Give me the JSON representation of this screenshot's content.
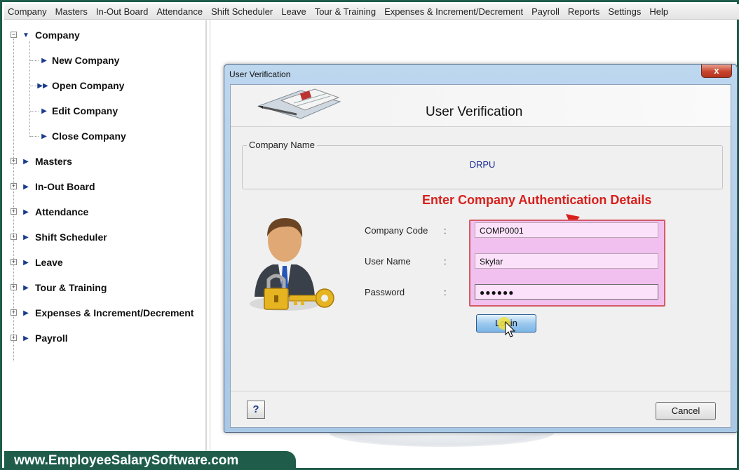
{
  "menu": [
    "Company",
    "Masters",
    "In-Out Board",
    "Attendance",
    "Shift Scheduler",
    "Leave",
    "Tour & Training",
    "Expenses & Increment/Decrement",
    "Payroll",
    "Reports",
    "Settings",
    "Help"
  ],
  "tree": {
    "root": "Company",
    "children": [
      "New Company",
      "Open Company",
      "Edit Company",
      "Close Company"
    ],
    "sections": [
      "Masters",
      "In-Out Board",
      "Attendance",
      "Shift Scheduler",
      "Leave",
      "Tour & Training",
      "Expenses & Increment/Decrement",
      "Payroll"
    ]
  },
  "dialog": {
    "window_title": "User Verification",
    "close_glyph": "x",
    "header_title": "User Verification",
    "group_label": "Company Name",
    "company_value": "DRPU",
    "callout": "Enter Company Authentication Details",
    "fields": {
      "company_code": {
        "label": "Company Code",
        "value": "COMP0001"
      },
      "user_name": {
        "label": "User Name",
        "value": "Skylar"
      },
      "password": {
        "label": "Password",
        "value": "●●●●●●"
      }
    },
    "colon": ":",
    "login_label": "Login",
    "help_glyph": "?",
    "cancel_label": "Cancel"
  },
  "footer": {
    "website": "www.EmployeeSalarySoftware.com"
  },
  "colors": {
    "accent_green": "#1f5c4a",
    "callout_red": "#d8201c",
    "highlight_pink": "#f1c0ee",
    "company_blue": "#1c2a99"
  }
}
